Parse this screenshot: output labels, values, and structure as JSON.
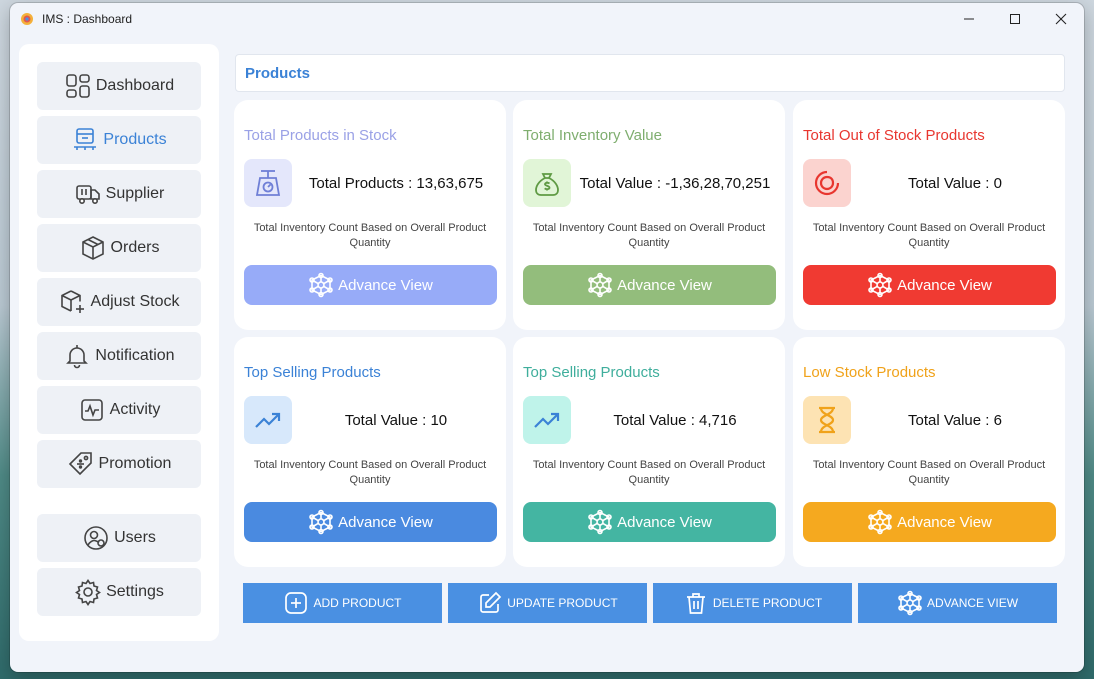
{
  "window": {
    "title": "IMS : Dashboard"
  },
  "sidebar": {
    "items": [
      {
        "label": "Dashboard",
        "icon": "dashboard-icon"
      },
      {
        "label": "Products",
        "icon": "products-icon"
      },
      {
        "label": "Supplier",
        "icon": "truck-icon"
      },
      {
        "label": "Orders",
        "icon": "box-icon"
      },
      {
        "label": "Adjust Stock",
        "icon": "adjust-stock-icon"
      },
      {
        "label": "Notification",
        "icon": "bell-icon"
      },
      {
        "label": "Activity",
        "icon": "activity-icon"
      },
      {
        "label": "Promotion",
        "icon": "tag-icon"
      },
      {
        "label": "Users",
        "icon": "user-icon"
      },
      {
        "label": "Settings",
        "icon": "gear-icon"
      }
    ]
  },
  "main": {
    "title": "Products"
  },
  "cards": [
    {
      "title": "Total Products in Stock",
      "value": "Total Products : 13,63,675",
      "desc": "Total Inventory Count Based on Overall Product Quantity",
      "button": "Advance View",
      "title_color": "#9aa1e6",
      "icon_bg": "#e4e7fb",
      "btn_color": "#97abf8",
      "icon": "scale-icon"
    },
    {
      "title": "Total Inventory Value",
      "value": "Total Value : -1,36,28,70,251",
      "desc": "Total Inventory Count Based on Overall Product Quantity",
      "button": "Advance View",
      "title_color": "#7fae6f",
      "icon_bg": "#e1f5d7",
      "btn_color": "#93bd7c",
      "icon": "money-bag-icon"
    },
    {
      "title": "Total Out of Stock Products",
      "value": "Total Value : 0",
      "desc": "Total Inventory Count Based on Overall Product Quantity",
      "button": "Advance View",
      "title_color": "#e8362f",
      "icon_bg": "#fbd3cf",
      "btn_color": "#f03a32",
      "icon": "out-of-stock-icon"
    },
    {
      "title": "Top Selling Products",
      "value": "Total Value : 10",
      "desc": "Total Inventory Count Based on Overall Product Quantity",
      "button": "Advance View",
      "title_color": "#3b82d6",
      "icon_bg": "#d7e8fb",
      "btn_color": "#4a8ae0",
      "icon": "trend-up-icon"
    },
    {
      "title": "Top Selling Products",
      "value": "Total Value : 4,716",
      "desc": "Total Inventory Count Based on Overall Product Quantity",
      "button": "Advance View",
      "title_color": "#3fae9c",
      "icon_bg": "#bff3ea",
      "btn_color": "#44b5a2",
      "icon": "trend-up-icon"
    },
    {
      "title": "Low Stock Products",
      "value": "Total Value : 6",
      "desc": "Total Inventory Count Based on Overall Product Quantity",
      "button": "Advance View",
      "title_color": "#f0a21a",
      "icon_bg": "#fde3b3",
      "btn_color": "#f5a91f",
      "icon": "hourglass-icon"
    }
  ],
  "actions": [
    {
      "label": "ADD PRODUCT",
      "icon": "plus-icon"
    },
    {
      "label": "UPDATE PRODUCT",
      "icon": "edit-icon"
    },
    {
      "label": "DELETE PRODUCT",
      "icon": "trash-icon"
    },
    {
      "label": "ADVANCE VIEW",
      "icon": "network-icon"
    }
  ]
}
